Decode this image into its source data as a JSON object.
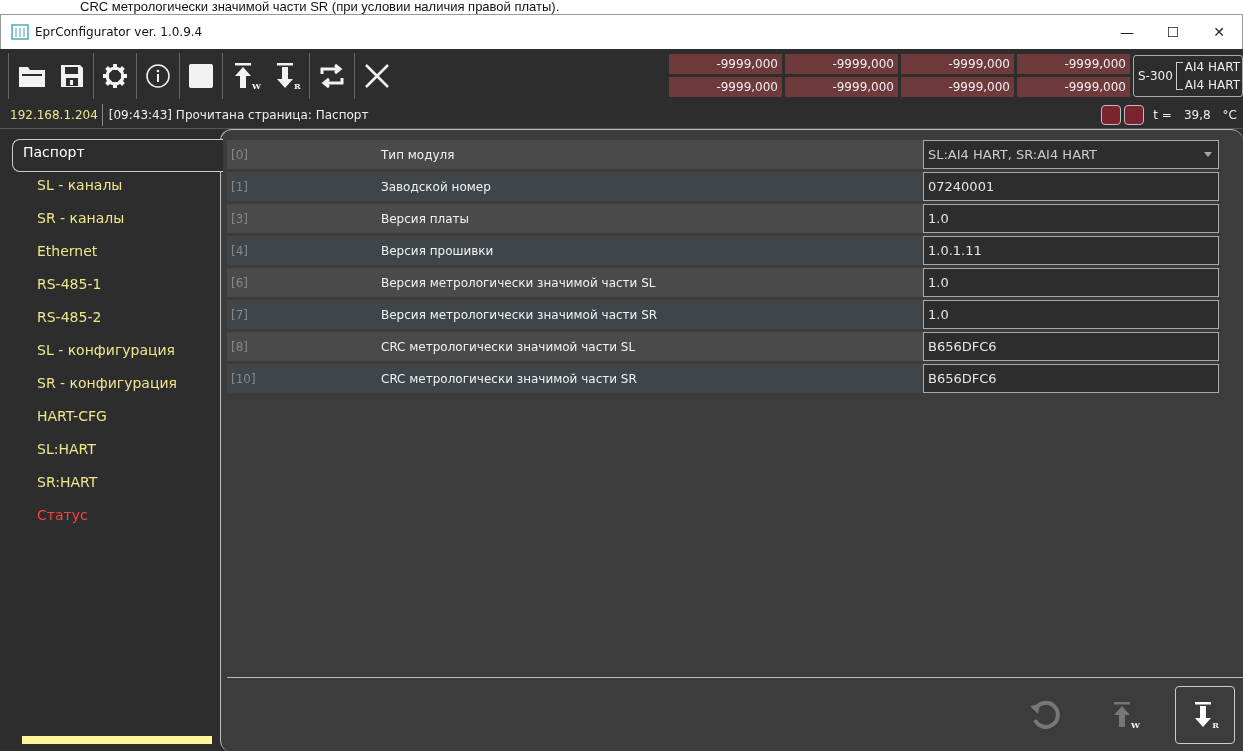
{
  "caption": "CRC метрологически значимой части SR (при условии наличия правой платы).",
  "window": {
    "title": "EprConfigurator ver. 1.0.9.4",
    "controls": [
      "—",
      "☐",
      "✕"
    ]
  },
  "toolbar": [
    {
      "kind": "folder"
    },
    {
      "kind": "save"
    },
    {
      "kind": "gear"
    },
    {
      "kind": "info"
    },
    {
      "kind": "stop"
    },
    {
      "kind": "write",
      "badge": "W"
    },
    {
      "kind": "read",
      "badge": "R"
    },
    {
      "kind": "sync"
    },
    {
      "kind": "close"
    }
  ],
  "readouts": [
    [
      "-9999,000",
      "-9999,000",
      "-9999,000",
      "-9999,000"
    ],
    [
      "-9999,000",
      "-9999,000",
      "-9999,000",
      "-9999,000"
    ]
  ],
  "device": {
    "name": "S-300",
    "slots": [
      "AI4 HART",
      "AI4 HART"
    ]
  },
  "status_bar": {
    "ip": "192.168.1.204",
    "message": "[09:43:43] Прочитана страница: Паспорт",
    "indicators": [
      {
        "color": "#7a2430"
      },
      {
        "color": "#7a2430"
      }
    ],
    "temp_label": "t =",
    "temp_value": "39,8",
    "temp_unit": "°C"
  },
  "sidebar": {
    "items": [
      {
        "label": "Паспорт",
        "selected": true,
        "color": "#ffffff"
      },
      {
        "label": "SL - каналы",
        "selected": false,
        "color": "#f0e68c"
      },
      {
        "label": "SR - каналы",
        "selected": false,
        "color": "#f0e68c"
      },
      {
        "label": "Ethernet",
        "selected": false,
        "color": "#f0e68c"
      },
      {
        "label": "RS-485-1",
        "selected": false,
        "color": "#f0e68c"
      },
      {
        "label": "RS-485-2",
        "selected": false,
        "color": "#f0e68c"
      },
      {
        "label": "SL - конфигурация",
        "selected": false,
        "color": "#f0e68c"
      },
      {
        "label": "SR - конфигурация",
        "selected": false,
        "color": "#f0e68c"
      },
      {
        "label": "HART-CFG",
        "selected": false,
        "color": "#f0e68c"
      },
      {
        "label": "SL:HART",
        "selected": false,
        "color": "#f0e68c"
      },
      {
        "label": "SR:HART",
        "selected": false,
        "color": "#f0e68c"
      },
      {
        "label": "Статус",
        "selected": false,
        "color": "#ff4040"
      }
    ]
  },
  "table": {
    "rows": [
      {
        "index": "[0]",
        "label": "Тип модуля",
        "value": "SL:AI4 HART, SR:AI4 HART",
        "kind": "dropdown"
      },
      {
        "index": "[1]",
        "label": "Заводской номер",
        "value": "07240001",
        "kind": "text"
      },
      {
        "index": "[3]",
        "label": "Версия платы",
        "value": "1.0",
        "kind": "text"
      },
      {
        "index": "[4]",
        "label": "Версия прошивки",
        "value": "1.0.1.11",
        "kind": "text"
      },
      {
        "index": "[6]",
        "label": "Версия метрологически значимой части SL",
        "value": "1.0",
        "kind": "text"
      },
      {
        "index": "[7]",
        "label": "Версия метрологически значимой части SR",
        "value": "1.0",
        "kind": "text"
      },
      {
        "index": "[8]",
        "label": "CRC метрологически значимой части SL",
        "value": "B656DFC6",
        "kind": "text"
      },
      {
        "index": "[10]",
        "label": "CRC метрологически значимой части SR",
        "value": "B656DFC6",
        "kind": "text"
      }
    ]
  },
  "actions": [
    {
      "kind": "refresh",
      "disabled": true
    },
    {
      "kind": "write",
      "badge": "W",
      "disabled": true
    },
    {
      "kind": "read",
      "badge": "R",
      "disabled": false
    }
  ]
}
